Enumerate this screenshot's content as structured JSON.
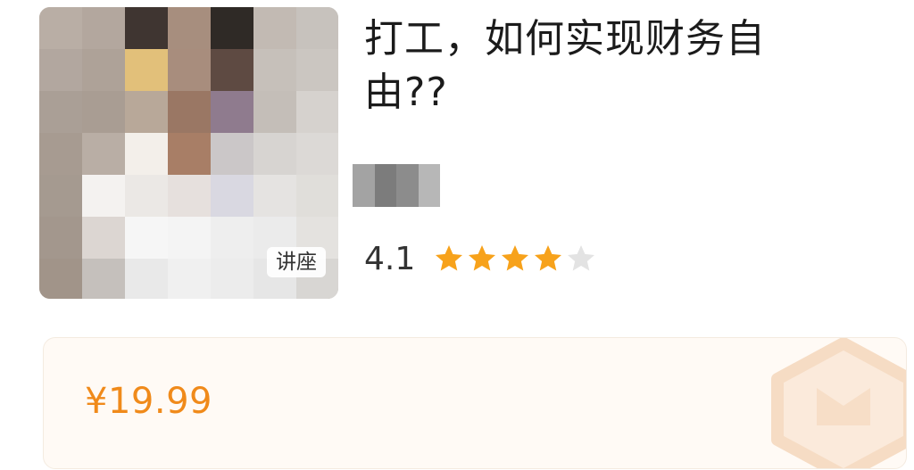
{
  "course": {
    "title": "打工，如何实现财务自由??",
    "thumbnail_tag": "讲座",
    "rating": "4.1",
    "rating_value": 4.1,
    "rating_max": 5,
    "price": "¥19.99"
  },
  "icons": {
    "star": "star-icon",
    "watermark": "shield-badge-icon"
  },
  "colors": {
    "price": "#f08a1a",
    "star_filled": "#f7a21b",
    "star_empty": "#e3e3e3",
    "card_bg": "#fffaf5"
  }
}
